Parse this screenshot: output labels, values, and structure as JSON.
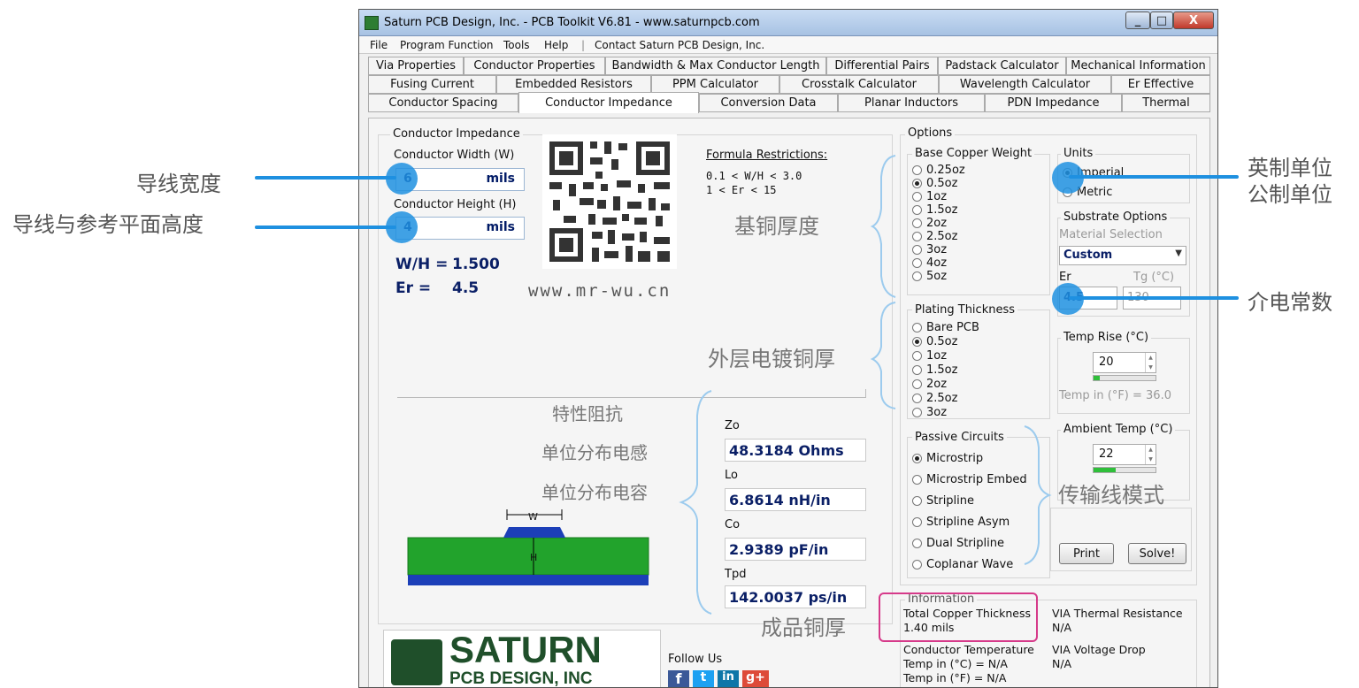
{
  "window": {
    "title": "Saturn PCB Design, Inc. - PCB Toolkit V6.81 - www.saturnpcb.com",
    "min_glyph": "_",
    "max_glyph": "□",
    "close_glyph": "X"
  },
  "menu": [
    "File",
    "Program Function",
    "Tools",
    "Help",
    "|",
    "Contact Saturn PCB Design, Inc."
  ],
  "tabs": {
    "row1": [
      "Via Properties",
      "Conductor Properties",
      "Bandwidth & Max Conductor Length",
      "Differential Pairs",
      "Padstack Calculator",
      "Mechanical Information"
    ],
    "row2": [
      "Fusing Current",
      "Embedded Resistors",
      "PPM Calculator",
      "Crosstalk Calculator",
      "Wavelength Calculator",
      "Er Effective"
    ],
    "row3": [
      "Conductor Spacing",
      "Conductor Impedance",
      "Conversion Data",
      "Planar Inductors",
      "PDN  Impedance",
      "Thermal"
    ]
  },
  "impedance": {
    "group_label": "Conductor Impedance",
    "width_label": "Conductor Width (W)",
    "width_value": "6",
    "width_unit": "mils",
    "height_label": "Conductor Height (H)",
    "height_value": "4",
    "height_unit": "mils",
    "wh_label": "W/H =",
    "wh_value": "1.500",
    "er_label": "Er =",
    "er_value": "4.5",
    "website": "www.mr-wu.cn",
    "formula_title": "Formula Restrictions:",
    "formula_1": "0.1 < W/H < 3.0",
    "formula_2": "1 < Er < 15"
  },
  "results": {
    "zo_label": "Zo",
    "zo_value": "48.3184 Ohms",
    "lo_label": "Lo",
    "lo_value": "6.8614 nH/in",
    "co_label": "Co",
    "co_value": "2.9389 pF/in",
    "tpd_label": "Tpd",
    "tpd_value": "142.0037 ps/in"
  },
  "diagram": {
    "w_label": "W",
    "h_label": "H"
  },
  "options": {
    "label": "Options",
    "base_copper_label": "Base Copper Weight",
    "base_copper": [
      "0.25oz",
      "0.5oz",
      "1oz",
      "1.5oz",
      "2oz",
      "2.5oz",
      "3oz",
      "4oz",
      "5oz"
    ],
    "plating_label": "Plating Thickness",
    "plating": [
      "Bare PCB",
      "0.5oz",
      "1oz",
      "1.5oz",
      "2oz",
      "2.5oz",
      "3oz"
    ],
    "passive_label": "Passive Circuits",
    "passive": [
      "Microstrip",
      "Microstrip Embed",
      "Stripline",
      "Stripline Asym",
      "Dual Stripline",
      "Coplanar Wave"
    ],
    "units_label": "Units",
    "units": [
      "Imperial",
      "Metric"
    ],
    "substrate_label": "Substrate Options",
    "material_label": "Material Selection",
    "material_value": "Custom",
    "er_label": "Er",
    "er_value": "4.5",
    "tg_label": "Tg (°C)",
    "tg_value": "130",
    "temp_rise_label": "Temp Rise (°C)",
    "temp_rise_value": "20",
    "temp_rise_bar": 0.1,
    "temp_f_label": "Temp in (°F) = 36.0",
    "ambient_label": "Ambient Temp (°C)",
    "ambient_value": "22",
    "ambient_bar": 0.35,
    "print_label": "Print",
    "solve_label": "Solve!"
  },
  "information": {
    "label": "Information",
    "total_copper_label": "Total Copper Thickness",
    "total_copper_value": "1.40 mils",
    "via_thermal_label": "VIA Thermal Resistance",
    "via_thermal_value": "N/A",
    "cond_temp_label": "Conductor Temperature",
    "cond_temp_c": "Temp in (°C) = N/A",
    "cond_temp_f": "Temp in (°F) = N/A",
    "via_drop_label": "VIA Voltage Drop",
    "via_drop_value": "N/A"
  },
  "logo": {
    "line1": "SATURN",
    "line2": "PCB DESIGN, INC",
    "follow": "Follow Us",
    "social": [
      "f",
      "t",
      "in",
      "g+"
    ]
  },
  "annotations": {
    "conductor_width": "导线宽度",
    "conductor_height": "导线与参考平面高度",
    "imperial": "英制单位",
    "metric": "公制单位",
    "dielectric": "介电常数",
    "base_copper": "基铜厚度",
    "plating": "外层电镀铜厚",
    "zo": "特性阻抗",
    "lo": "单位分布电感",
    "co": "单位分布电容",
    "mode": "传输线模式",
    "finished_copper": "成品铜厚"
  },
  "colors": {
    "accent": "#1e90e0",
    "highlight": "#d63a8a",
    "value_text": "#0a1f66",
    "board_green": "#22a32c",
    "board_blue": "#1c3fb8"
  }
}
